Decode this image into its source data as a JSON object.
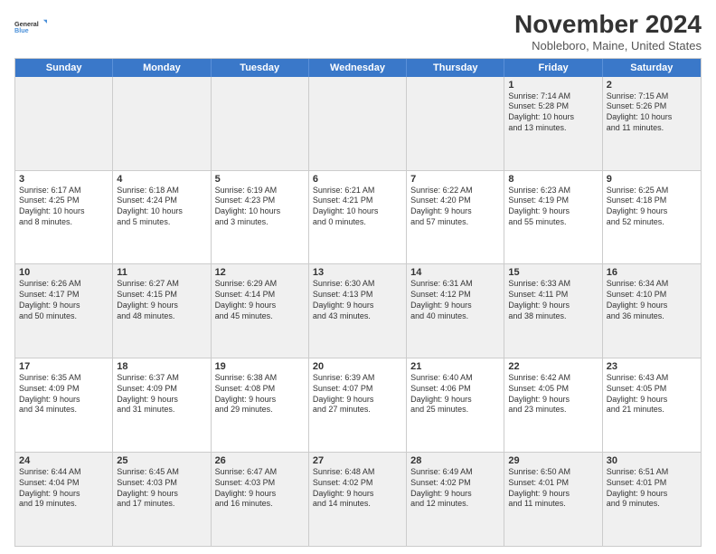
{
  "logo": {
    "line1": "General",
    "line2": "Blue"
  },
  "title": "November 2024",
  "location": "Nobleboro, Maine, United States",
  "days_of_week": [
    "Sunday",
    "Monday",
    "Tuesday",
    "Wednesday",
    "Thursday",
    "Friday",
    "Saturday"
  ],
  "weeks": [
    [
      {
        "day": "",
        "info": ""
      },
      {
        "day": "",
        "info": ""
      },
      {
        "day": "",
        "info": ""
      },
      {
        "day": "",
        "info": ""
      },
      {
        "day": "",
        "info": ""
      },
      {
        "day": "1",
        "info": "Sunrise: 7:14 AM\nSunset: 5:28 PM\nDaylight: 10 hours\nand 13 minutes."
      },
      {
        "day": "2",
        "info": "Sunrise: 7:15 AM\nSunset: 5:26 PM\nDaylight: 10 hours\nand 11 minutes."
      }
    ],
    [
      {
        "day": "3",
        "info": "Sunrise: 6:17 AM\nSunset: 4:25 PM\nDaylight: 10 hours\nand 8 minutes."
      },
      {
        "day": "4",
        "info": "Sunrise: 6:18 AM\nSunset: 4:24 PM\nDaylight: 10 hours\nand 5 minutes."
      },
      {
        "day": "5",
        "info": "Sunrise: 6:19 AM\nSunset: 4:23 PM\nDaylight: 10 hours\nand 3 minutes."
      },
      {
        "day": "6",
        "info": "Sunrise: 6:21 AM\nSunset: 4:21 PM\nDaylight: 10 hours\nand 0 minutes."
      },
      {
        "day": "7",
        "info": "Sunrise: 6:22 AM\nSunset: 4:20 PM\nDaylight: 9 hours\nand 57 minutes."
      },
      {
        "day": "8",
        "info": "Sunrise: 6:23 AM\nSunset: 4:19 PM\nDaylight: 9 hours\nand 55 minutes."
      },
      {
        "day": "9",
        "info": "Sunrise: 6:25 AM\nSunset: 4:18 PM\nDaylight: 9 hours\nand 52 minutes."
      }
    ],
    [
      {
        "day": "10",
        "info": "Sunrise: 6:26 AM\nSunset: 4:17 PM\nDaylight: 9 hours\nand 50 minutes."
      },
      {
        "day": "11",
        "info": "Sunrise: 6:27 AM\nSunset: 4:15 PM\nDaylight: 9 hours\nand 48 minutes."
      },
      {
        "day": "12",
        "info": "Sunrise: 6:29 AM\nSunset: 4:14 PM\nDaylight: 9 hours\nand 45 minutes."
      },
      {
        "day": "13",
        "info": "Sunrise: 6:30 AM\nSunset: 4:13 PM\nDaylight: 9 hours\nand 43 minutes."
      },
      {
        "day": "14",
        "info": "Sunrise: 6:31 AM\nSunset: 4:12 PM\nDaylight: 9 hours\nand 40 minutes."
      },
      {
        "day": "15",
        "info": "Sunrise: 6:33 AM\nSunset: 4:11 PM\nDaylight: 9 hours\nand 38 minutes."
      },
      {
        "day": "16",
        "info": "Sunrise: 6:34 AM\nSunset: 4:10 PM\nDaylight: 9 hours\nand 36 minutes."
      }
    ],
    [
      {
        "day": "17",
        "info": "Sunrise: 6:35 AM\nSunset: 4:09 PM\nDaylight: 9 hours\nand 34 minutes."
      },
      {
        "day": "18",
        "info": "Sunrise: 6:37 AM\nSunset: 4:09 PM\nDaylight: 9 hours\nand 31 minutes."
      },
      {
        "day": "19",
        "info": "Sunrise: 6:38 AM\nSunset: 4:08 PM\nDaylight: 9 hours\nand 29 minutes."
      },
      {
        "day": "20",
        "info": "Sunrise: 6:39 AM\nSunset: 4:07 PM\nDaylight: 9 hours\nand 27 minutes."
      },
      {
        "day": "21",
        "info": "Sunrise: 6:40 AM\nSunset: 4:06 PM\nDaylight: 9 hours\nand 25 minutes."
      },
      {
        "day": "22",
        "info": "Sunrise: 6:42 AM\nSunset: 4:05 PM\nDaylight: 9 hours\nand 23 minutes."
      },
      {
        "day": "23",
        "info": "Sunrise: 6:43 AM\nSunset: 4:05 PM\nDaylight: 9 hours\nand 21 minutes."
      }
    ],
    [
      {
        "day": "24",
        "info": "Sunrise: 6:44 AM\nSunset: 4:04 PM\nDaylight: 9 hours\nand 19 minutes."
      },
      {
        "day": "25",
        "info": "Sunrise: 6:45 AM\nSunset: 4:03 PM\nDaylight: 9 hours\nand 17 minutes."
      },
      {
        "day": "26",
        "info": "Sunrise: 6:47 AM\nSunset: 4:03 PM\nDaylight: 9 hours\nand 16 minutes."
      },
      {
        "day": "27",
        "info": "Sunrise: 6:48 AM\nSunset: 4:02 PM\nDaylight: 9 hours\nand 14 minutes."
      },
      {
        "day": "28",
        "info": "Sunrise: 6:49 AM\nSunset: 4:02 PM\nDaylight: 9 hours\nand 12 minutes."
      },
      {
        "day": "29",
        "info": "Sunrise: 6:50 AM\nSunset: 4:01 PM\nDaylight: 9 hours\nand 11 minutes."
      },
      {
        "day": "30",
        "info": "Sunrise: 6:51 AM\nSunset: 4:01 PM\nDaylight: 9 hours\nand 9 minutes."
      }
    ]
  ]
}
